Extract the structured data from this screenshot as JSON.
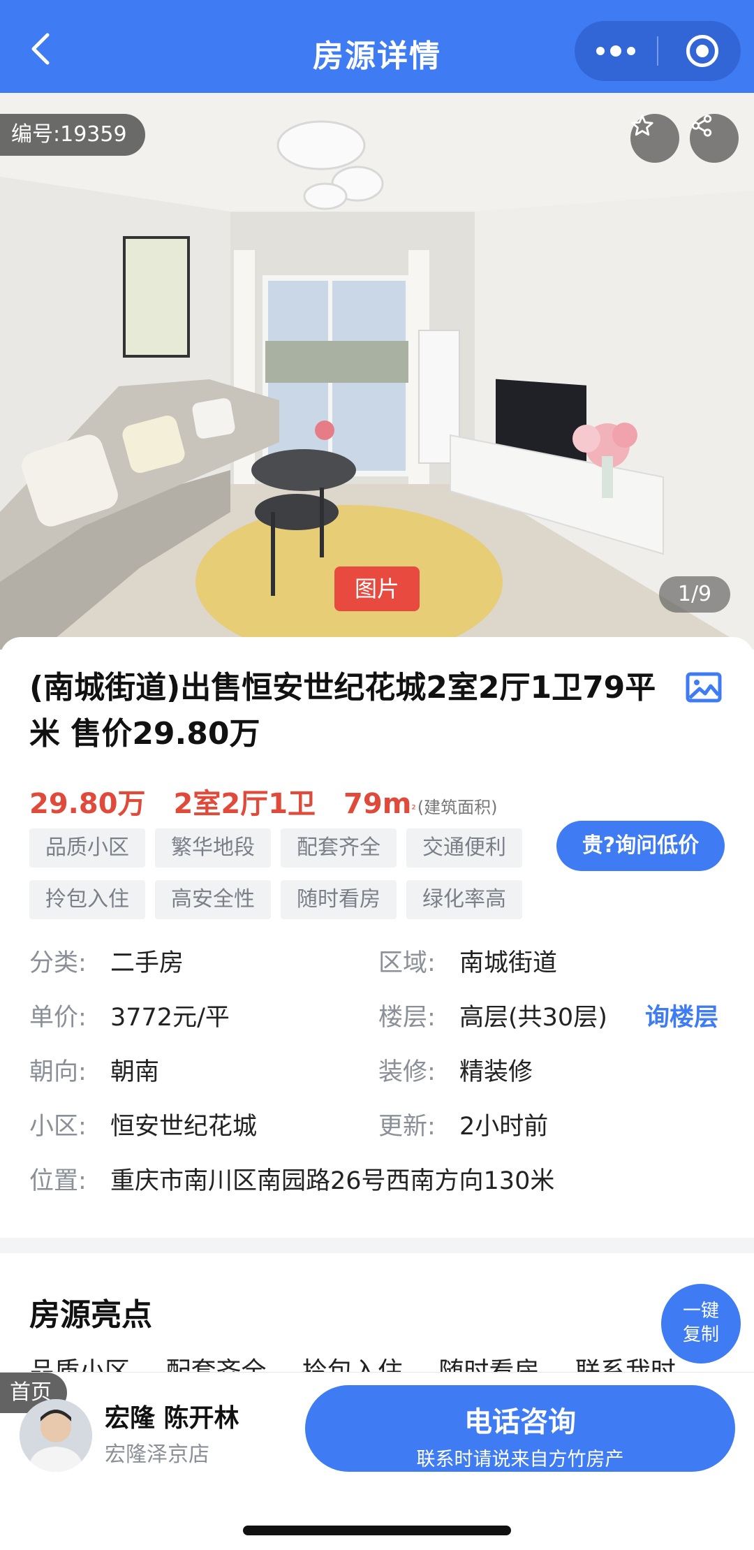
{
  "header": {
    "title": "房源详情",
    "back_icon": "chevron-left-icon",
    "more_icon": "more-dots-icon",
    "target_icon": "target-circle-icon",
    "color": "#3f7cf3"
  },
  "photo": {
    "id_label": "编号:19359",
    "tag": "图片",
    "counter": "1/9",
    "favorite_icon": "star-icon",
    "share_icon": "share-icon"
  },
  "listing": {
    "title": "(南城街道)出售恒安世纪花城2室2厅1卫79平米 售价29.80万",
    "price": "29.80万",
    "layout": "2室2厅1卫",
    "area": "79m",
    "area_sup": "²",
    "area_note": "(建筑面积)",
    "accent_color": "#e04a3a",
    "tags": [
      "品质小区",
      "繁华地段",
      "配套齐全",
      "交通便利",
      "拎包入住",
      "高安全性",
      "随时看房",
      "绿化率高"
    ],
    "ask_price_button": "贵?询问低价"
  },
  "details": {
    "category_label": "分类:",
    "category": "二手房",
    "region_label": "区域:",
    "region": "南城街道",
    "unit_price_label": "单价:",
    "unit_price": "3772元/平",
    "floor_label": "楼层:",
    "floor": "高层(共30层)",
    "floor_link": "询楼层",
    "orientation_label": "朝向:",
    "orientation": "朝南",
    "decoration_label": "装修:",
    "decoration": "精装修",
    "community_label": "小区:",
    "community": "恒安世纪花城",
    "updated_label": "更新:",
    "updated": "2小时前",
    "location_label": "位置:",
    "location": "重庆市南川区南园路26号西南方向130米"
  },
  "highlights": {
    "title": "房源亮点",
    "items": [
      "品质小区",
      "配套齐全",
      "拎包入住",
      "随时看房",
      "联系我时"
    ],
    "copy_button": "一键复制"
  },
  "bottom_bar": {
    "home_label": "首页",
    "agent_name": "宏隆 陈开林",
    "agent_store": "宏隆泽京店",
    "call_label": "电话咨询",
    "call_note": "联系时请说来自方竹房产"
  }
}
